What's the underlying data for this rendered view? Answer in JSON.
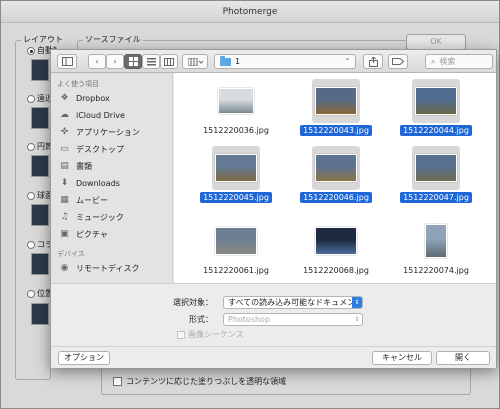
{
  "window": {
    "title": "Photomerge",
    "layout_group_label": "レイアウト",
    "source_group_label": "ソースファイル",
    "ok_label": "OK",
    "layout_options": [
      {
        "label": "自動設定",
        "selected": true
      },
      {
        "label": "遠近法",
        "selected": false
      },
      {
        "label": "円筒法",
        "selected": false
      },
      {
        "label": "球面法",
        "selected": false
      },
      {
        "label": "コラージュ",
        "selected": false
      },
      {
        "label": "位置の変更",
        "selected": false
      }
    ],
    "content_aware_fill_label": "コンテンツに応じた塗りつぶしを透明な領域"
  },
  "dialog": {
    "path_folder": "1",
    "search_placeholder": "検索",
    "sidebar": {
      "favorites_label": "よく使う項目",
      "favorites": [
        {
          "label": "Dropbox",
          "icon": "dropbox-icon"
        },
        {
          "label": "iCloud Drive",
          "icon": "cloud-icon"
        },
        {
          "label": "アプリケーション",
          "icon": "applications-icon"
        },
        {
          "label": "デスクトップ",
          "icon": "desktop-icon"
        },
        {
          "label": "書類",
          "icon": "documents-icon"
        },
        {
          "label": "Downloads",
          "icon": "downloads-icon"
        },
        {
          "label": "ムービー",
          "icon": "movies-icon"
        },
        {
          "label": "ミュージック",
          "icon": "music-icon"
        },
        {
          "label": "ピクチャ",
          "icon": "pictures-icon"
        }
      ],
      "devices_label": "デバイス",
      "devices": [
        {
          "label": "リモートディスク",
          "icon": "disc-icon"
        }
      ]
    },
    "files": [
      {
        "name": "1512220036.jpg",
        "selected": false,
        "thumb_colors": [
          "#d7dce0",
          "#7a8a92"
        ]
      },
      {
        "name": "1512220043.jpg",
        "selected": true,
        "thumb_colors": [
          "#566a86",
          "#8a6a3c"
        ]
      },
      {
        "name": "1512220044.jpg",
        "selected": true,
        "thumb_colors": [
          "#506c8f",
          "#6a6a4a"
        ]
      },
      {
        "name": "1512220045.jpg",
        "selected": true,
        "thumb_colors": [
          "#647a94",
          "#7e6a44"
        ]
      },
      {
        "name": "1512220046.jpg",
        "selected": true,
        "thumb_colors": [
          "#5d7290",
          "#8a7448"
        ]
      },
      {
        "name": "1512220047.jpg",
        "selected": true,
        "thumb_colors": [
          "#58708e",
          "#6c6d50"
        ]
      },
      {
        "name": "1512220061.jpg",
        "selected": false,
        "thumb_colors": [
          "#6e7e92",
          "#8a8a82"
        ]
      },
      {
        "name": "1512220068.jpg",
        "selected": false,
        "thumb_colors": [
          "#1d2a40",
          "#4b6a9a"
        ]
      },
      {
        "name": "1512220074.jpg",
        "selected": false,
        "thumb_colors": [
          "#8fa2b8",
          "#5e6a74"
        ]
      }
    ],
    "enable_label": "選択対象：",
    "enable_value": "すべての読み込み可能なドキュメント",
    "format_label": "形式：",
    "format_value": "Photoshop",
    "image_sequence_label": "画像シーケンス",
    "options_button": "オプション",
    "cancel_button": "キャンセル",
    "open_button": "開く"
  },
  "colors": {
    "selection": "#1f66d6",
    "folder": "#5aa8e8"
  }
}
